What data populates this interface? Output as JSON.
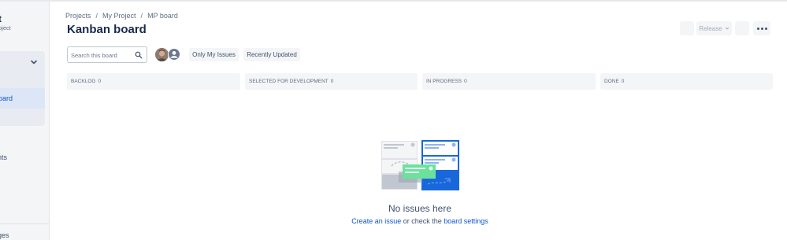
{
  "sidebar": {
    "project_title": "t",
    "project_sub": "oject",
    "active_item": "oard",
    "item_components": "nts",
    "item_pages": "ges"
  },
  "breadcrumb": [
    "Projects",
    "My Project",
    "MP board"
  ],
  "breadcrumb_sep": "/",
  "page_title": "Kanban board",
  "toolbar": {
    "release_label": "Release"
  },
  "filters": {
    "search_placeholder": "Search this board",
    "only_my_issues": "Only My Issues",
    "recently_updated": "Recently Updated"
  },
  "columns": [
    {
      "name": "BACKLOG",
      "count": "0"
    },
    {
      "name": "SELECTED FOR DEVELOPMENT",
      "count": "0"
    },
    {
      "name": "IN PROGRESS",
      "count": "0"
    },
    {
      "name": "DONE",
      "count": "0"
    }
  ],
  "empty_state": {
    "title": "No issues here",
    "create_link": "Create an issue",
    "middle_text": " or check the ",
    "settings_link": "board settings"
  },
  "colors": {
    "accent": "#0c55cf",
    "illustration_blue": "#1868db",
    "illustration_green": "#6be29c"
  }
}
